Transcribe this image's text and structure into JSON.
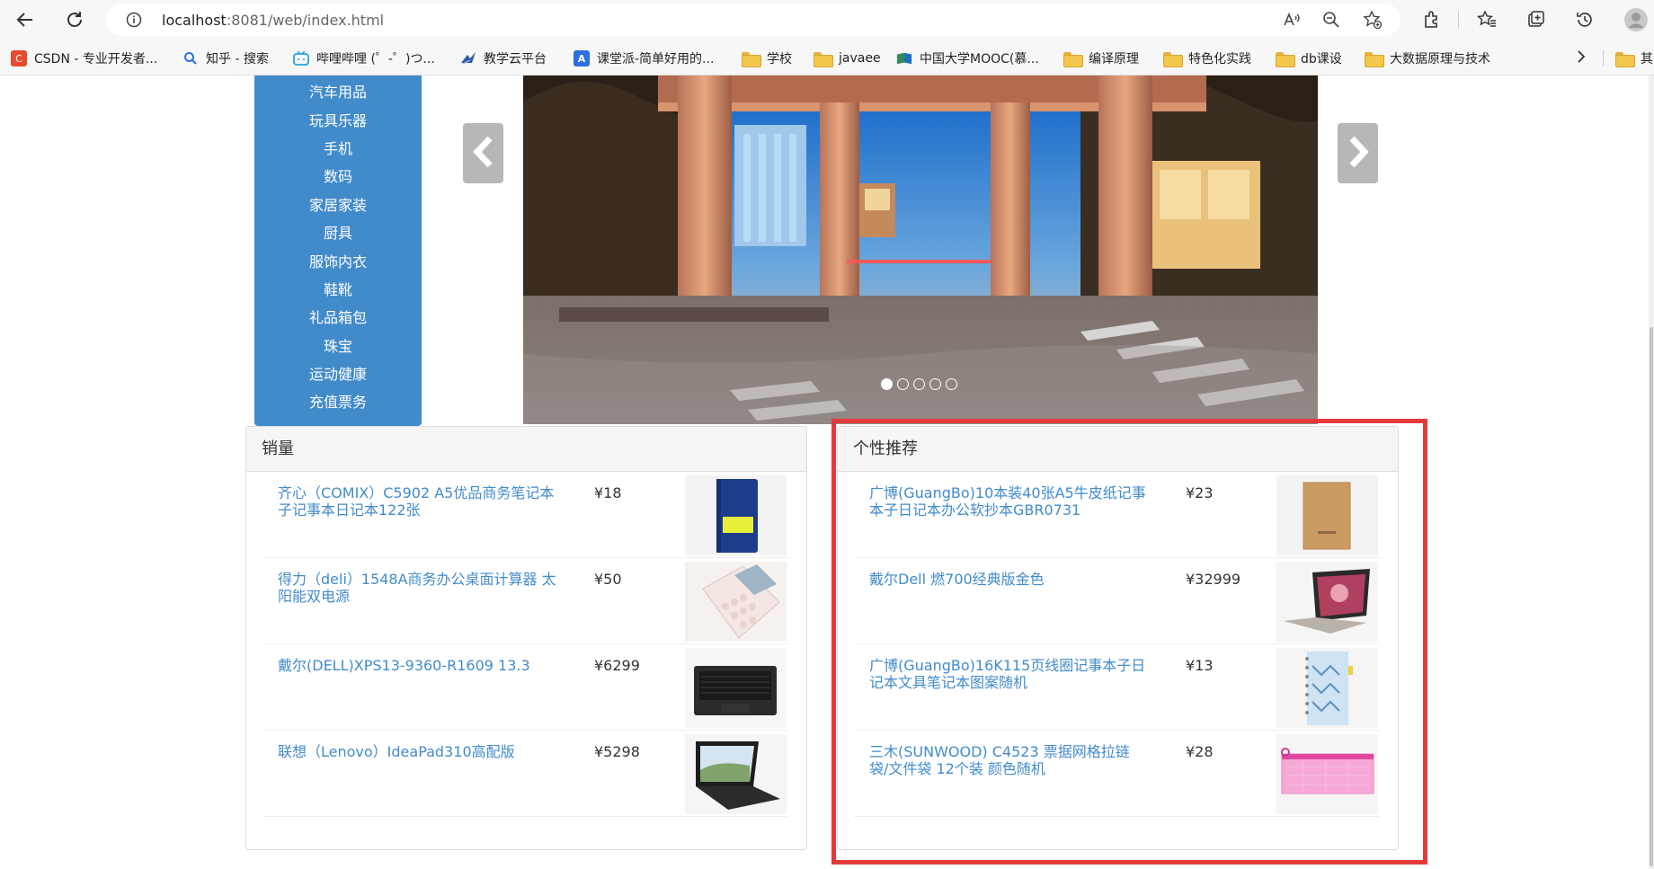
{
  "browser": {
    "url_host": "localhost",
    "url_rest": ":8081/web/index.html",
    "bookmarks": [
      {
        "label": "CSDN - 专业开发者...",
        "icon": "csdn-icon",
        "color": "#e8492f",
        "glyph": "C"
      },
      {
        "label": "知乎 - 搜索",
        "icon": "search-icon",
        "color": "#ffffff",
        "glyph": ""
      },
      {
        "label": "哔哩哔哩 (゜-゜)つ...",
        "icon": "bilibili-icon",
        "color": "#ffffff",
        "glyph": ""
      },
      {
        "label": "教学云平台",
        "icon": "teaching-cloud-icon",
        "color": "#ffffff",
        "glyph": ""
      },
      {
        "label": "课堂派-简单好用的...",
        "icon": "ketangpai-icon",
        "color": "#2d6fe0",
        "glyph": "A"
      },
      {
        "label": "学校",
        "icon": "folder-icon"
      },
      {
        "label": "javaee",
        "icon": "folder-icon"
      },
      {
        "label": "中国大学MOOC(慕...",
        "icon": "mooc-icon",
        "color": "#ffffff",
        "glyph": ""
      },
      {
        "label": "编译原理",
        "icon": "folder-icon"
      },
      {
        "label": "特色化实践",
        "icon": "folder-icon"
      },
      {
        "label": "db课设",
        "icon": "folder-icon"
      },
      {
        "label": "大数据原理与技术",
        "icon": "folder-icon"
      },
      {
        "label": "其",
        "icon": "folder-icon"
      }
    ]
  },
  "categories": [
    "汽车用品",
    "玩具乐器",
    "手机",
    "数码",
    "家居家装",
    "厨具",
    "服饰内衣",
    "鞋靴",
    "礼品箱包",
    "珠宝",
    "运动健康",
    "充值票务"
  ],
  "carousel": {
    "slide_count": 5,
    "active_index": 0
  },
  "sales_panel": {
    "title": "销量",
    "items": [
      {
        "name": "齐心（COMIX）C5902 A5优品商务笔记本子记事本日记本122张",
        "price": "¥18",
        "thumb": "notebook-blue"
      },
      {
        "name": "得力（deli）1548A商务办公桌面计算器 太阳能双电源",
        "price": "¥50",
        "thumb": "calculator"
      },
      {
        "name": "戴尔(DELL)XPS13-9360-R1609 13.3",
        "price": "¥6299",
        "thumb": "laptop-black"
      },
      {
        "name": "联想（Lenovo）IdeaPad310高配版",
        "price": "¥5298",
        "thumb": "laptop-lenovo"
      }
    ]
  },
  "recommend_panel": {
    "title": "个性推荐",
    "items": [
      {
        "name": "广博(GuangBo)10本装40张A5牛皮纸记事本子日记本办公软抄本GBR0731",
        "price": "¥23",
        "thumb": "kraft-notebook"
      },
      {
        "name": "戴尔Dell 燃700经典版金色",
        "price": "¥32999",
        "thumb": "laptop-gold"
      },
      {
        "name": "广博(GuangBo)16K115页线圈记事本子日记本文具笔记本图案随机",
        "price": "¥13",
        "thumb": "spiral-notebook"
      },
      {
        "name": "三木(SUNWOOD) C4523 票据网格拉链袋/文件袋 12个装 颜色随机",
        "price": "¥28",
        "thumb": "zipper-bag"
      }
    ]
  },
  "colors": {
    "accent": "#428bca",
    "highlight": "#e53a3a"
  }
}
